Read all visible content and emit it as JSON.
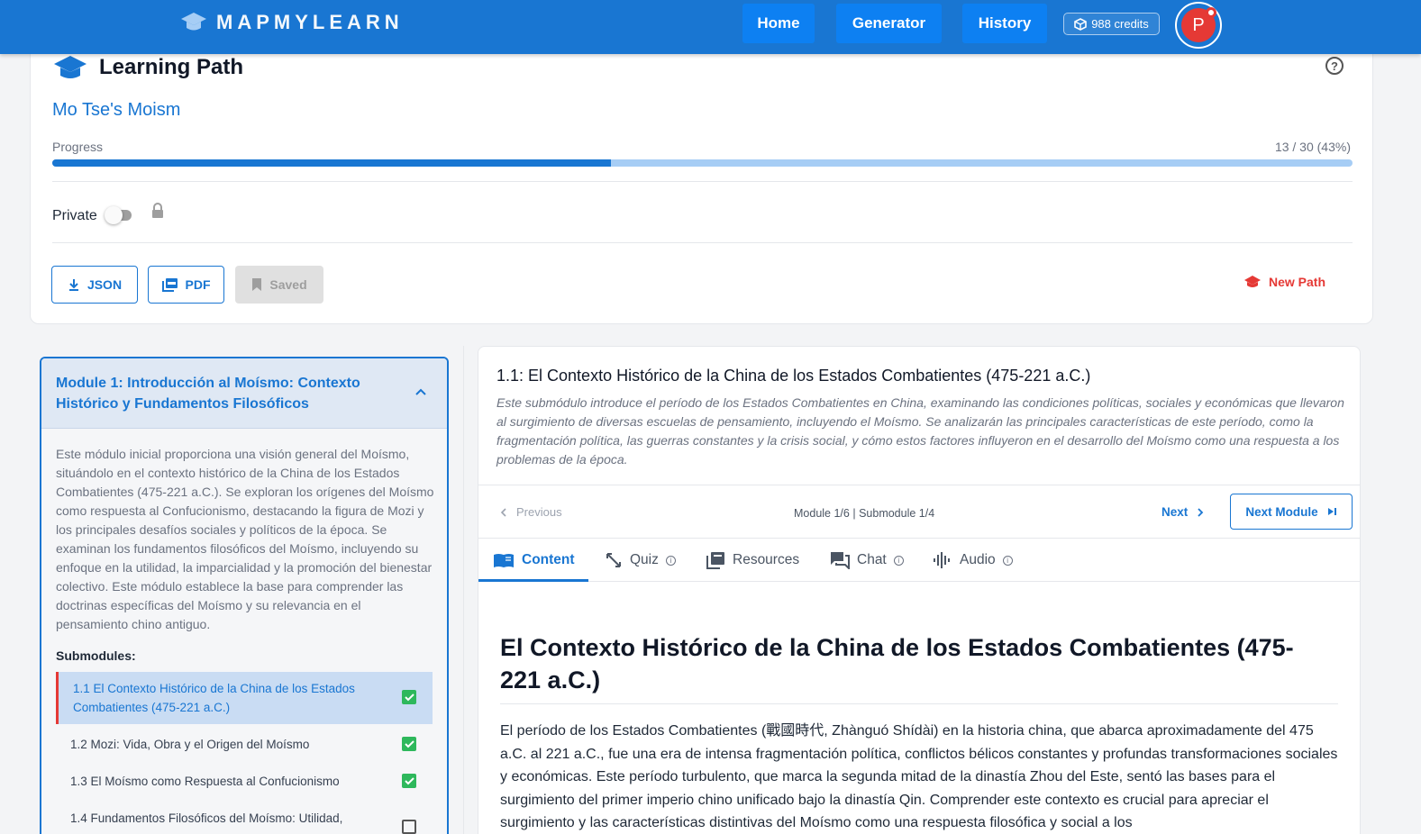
{
  "brand": {
    "name": "MAPMYLEARN"
  },
  "nav": {
    "home": "Home",
    "generator": "Generator",
    "history": "History",
    "credits": "988 credits",
    "avatar_initial": "P"
  },
  "learning_path": {
    "heading": "Learning Path",
    "help_icon": "?",
    "name": "Mo Tse's Moism",
    "progress_label": "Progress",
    "progress_count": "13 / 30 (43%)",
    "progress_fraction": 0.43,
    "private_label": "Private",
    "json_button": "JSON",
    "pdf_button": "PDF",
    "saved_button": "Saved",
    "new_path_button": "New Path"
  },
  "module": {
    "title": "Module 1: Introducción al Moísmo: Contexto Histórico y Fundamentos Filosóficos",
    "description": "Este módulo inicial proporciona una visión general del Moísmo, situándolo en el contexto histórico de la China de los Estados Combatientes (475-221 a.C.). Se exploran los orígenes del Moísmo como respuesta al Confucionismo, destacando la figura de Mozi y los principales desafíos sociales y políticos de la época. Se examinan los fundamentos filosóficos del Moísmo, incluyendo su enfoque en la utilidad, la imparcialidad y la promoción del bienestar colectivo. Este módulo establece la base para comprender las doctrinas específicas del Moísmo y su relevancia en el pensamiento chino antiguo.",
    "submodules_heading": "Submodules:",
    "submodules": [
      {
        "label": "1.1 El Contexto Histórico de la China de los Estados Combatientes (475-221 a.C.)",
        "done": true
      },
      {
        "label": "1.2 Mozi: Vida, Obra y el Origen del Moísmo",
        "done": true
      },
      {
        "label": "1.3 El Moísmo como Respuesta al Confucionismo",
        "done": true
      },
      {
        "label": "1.4 Fundamentos Filosóficos del Moísmo: Utilidad,",
        "done": false
      }
    ]
  },
  "content": {
    "submodule_title": "1.1: El Contexto Histórico de la China de los Estados Combatientes (475-221 a.C.)",
    "submodule_desc": "Este submódulo introduce el período de los Estados Combatientes en China, examinando las condiciones políticas, sociales y económicas que llevaron al surgimiento de diversas escuelas de pensamiento, incluyendo el Moísmo. Se analizarán las principales características de este período, como la fragmentación política, las guerras constantes y la crisis social, y cómo estos factores influyeron en el desarrollo del Moísmo como una respuesta a los problemas de la época.",
    "previous": "Previous",
    "position_module": "Module 1/6",
    "position_sep": "|",
    "position_submodule": "Submodule 1/4",
    "next": "Next",
    "next_module": "Next Module",
    "tabs": {
      "content": "Content",
      "quiz": "Quiz",
      "resources": "Resources",
      "chat": "Chat",
      "audio": "Audio"
    },
    "article_title": "El Contexto Histórico de la China de los Estados Combatientes (475-221 a.C.)",
    "article_body": "El período de los Estados Combatientes (戰國時代, Zhànguó Shídài) en la historia china, que abarca aproximadamente del 475 a.C. al 221 a.C., fue una era de intensa fragmentación política, conflictos bélicos constantes y profundas transformaciones sociales y económicas. Este período turbulento, que marca la segunda mitad de la dinastía Zhou del Este, sentó las bases para el surgimiento del primer imperio chino unificado bajo la dinastía Qin. Comprender este contexto es crucial para apreciar el surgimiento y las características distintivas del Moísmo como una respuesta filosófica y social a los"
  },
  "colors": {
    "primary": "#1976d2",
    "accent": "#e53935",
    "success": "#2eb85c"
  }
}
